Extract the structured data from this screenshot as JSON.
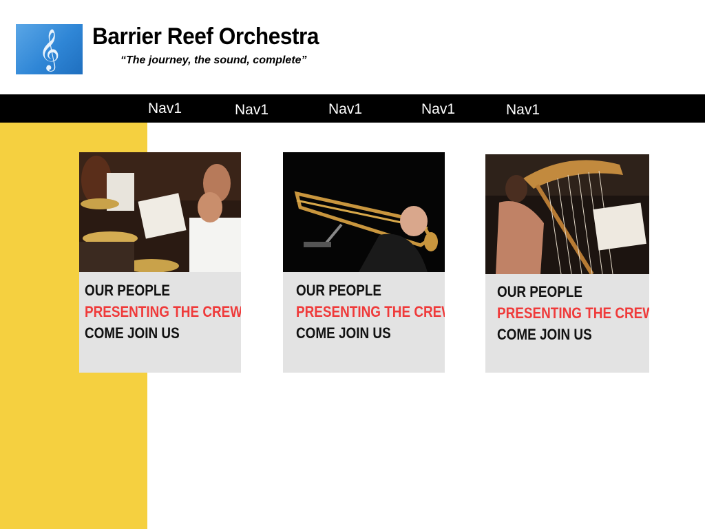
{
  "header": {
    "logo_icon": "treble-clef-icon",
    "logo_glyph": "𝄞",
    "title": "Barrier Reef Orchestra",
    "tagline": "“The journey, the sound, complete”"
  },
  "nav": {
    "items": [
      {
        "label": "Nav1"
      },
      {
        "label": "Nav1"
      },
      {
        "label": "Nav1"
      },
      {
        "label": "Nav1"
      },
      {
        "label": "Nav1"
      }
    ]
  },
  "colors": {
    "side_panel": "#f5d040",
    "nav_background": "#000000",
    "card_background": "#e3e3e3",
    "accent_red": "#ef3a3a"
  },
  "cards": [
    {
      "photo": "drummer-photo",
      "line1": "OUR PEOPLE",
      "line2": "PRESENTING THE CREW",
      "line3": "COME JOIN US"
    },
    {
      "photo": "trombonist-photo",
      "line1": "OUR PEOPLE",
      "line2": "PRESENTING THE CREW",
      "line3": "COME JOIN US"
    },
    {
      "photo": "harpist-photo",
      "line1": "OUR PEOPLE",
      "line2": "PRESENTING THE CREW",
      "line3": "COME JOIN US"
    }
  ]
}
